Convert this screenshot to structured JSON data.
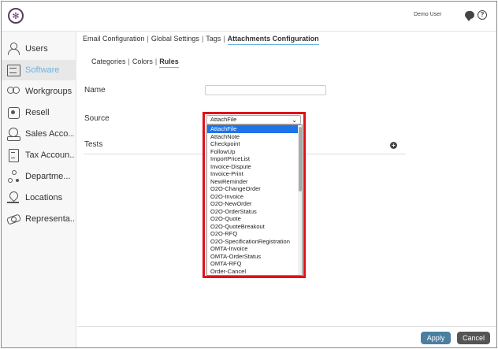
{
  "header": {
    "user": "Demo User"
  },
  "sidebar": {
    "items": [
      {
        "label": "Users",
        "icon": "user-icon",
        "active": false
      },
      {
        "label": "Software",
        "icon": "software-icon",
        "active": true
      },
      {
        "label": "Workgroups",
        "icon": "workgroups-icon",
        "active": false
      },
      {
        "label": "Resell",
        "icon": "resell-icon",
        "active": false
      },
      {
        "label": "Sales Acco...",
        "icon": "sales-accounts-icon",
        "active": false
      },
      {
        "label": "Tax Accoun...",
        "icon": "tax-accounts-icon",
        "active": false
      },
      {
        "label": "Departme...",
        "icon": "departments-icon",
        "active": false
      },
      {
        "label": "Locations",
        "icon": "locations-icon",
        "active": false
      },
      {
        "label": "Representa...",
        "icon": "representatives-icon",
        "active": false
      }
    ],
    "active_color": "#6db3e0"
  },
  "tabs": {
    "email": "Email Configuration",
    "global": "Global Settings",
    "tags": "Tags",
    "attachments": "Attachments Configuration",
    "sep": "|"
  },
  "subtabs": {
    "categories": "Categories",
    "colors": "Colors",
    "rules": "Rules",
    "sep": "|"
  },
  "form": {
    "name_label": "Name",
    "name_value": "",
    "source_label": "Source",
    "source_value": "AttachFile",
    "tests_label": "Tests"
  },
  "source_options": [
    "AttachFile",
    "AttachNote",
    "Checkpoint",
    "FollowUp",
    "ImportPriceList",
    "Invoice-Dispute",
    "Invoice-Print",
    "NewReminder",
    "O2O-ChangeOrder",
    "O2O-Invoice",
    "O2O-NewOrder",
    "O2O-OrderStatus",
    "O2O-Quote",
    "O2O-QuoteBreakout",
    "O2O-RFQ",
    "O2O-SpecificationRegistration",
    "OMTA-Invoice",
    "OMTA-OrderStatus",
    "OMTA-RFQ",
    "Order-Cancel"
  ],
  "buttons": {
    "apply": "Apply",
    "cancel": "Cancel"
  },
  "colors": {
    "highlight": "#e0101a",
    "selected_option": "#1e73e8",
    "apply": "#4a7fa0",
    "cancel": "#555555"
  }
}
